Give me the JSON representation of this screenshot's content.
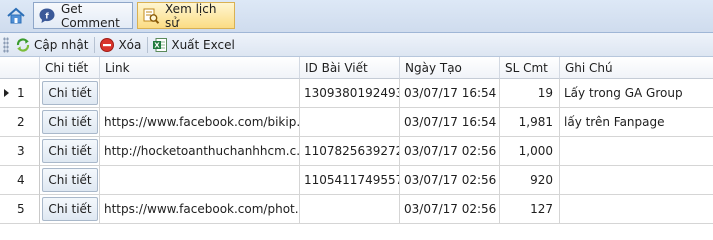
{
  "tabs": [
    {
      "label": "Get Comment",
      "icon": "facebook-comment-icon"
    },
    {
      "label": "Xem lịch sử",
      "icon": "history-search-icon"
    }
  ],
  "toolbar": {
    "refresh_label": "Cập nhật",
    "delete_label": "Xóa",
    "export_label": "Xuất Excel"
  },
  "columns": [
    "Chi tiết",
    "Link",
    "ID Bài Viết",
    "Ngày Tạo",
    "SL Cmt",
    "Ghi Chú"
  ],
  "rows": [
    {
      "num": "1",
      "detail": "Chi tiết",
      "link": "",
      "post_id": "1309380192493...",
      "date": "03/07/17 16:54",
      "count": "19",
      "note": "Lấy trong GA Group"
    },
    {
      "num": "2",
      "detail": "Chi tiết",
      "link": "https://www.facebook.com/bikip...",
      "post_id": "",
      "date": "03/07/17 16:54",
      "count": "1,981",
      "note": "lấy trên Fanpage"
    },
    {
      "num": "3",
      "detail": "Chi tiết",
      "link": "http://hocketoanthuchanhhcm.c...",
      "post_id": "1107825639272...",
      "date": "03/07/17 02:56",
      "count": "1,000",
      "note": ""
    },
    {
      "num": "4",
      "detail": "Chi tiết",
      "link": "",
      "post_id": "1105411749557...",
      "date": "03/07/17 02:56",
      "count": "920",
      "note": ""
    },
    {
      "num": "5",
      "detail": "Chi tiết",
      "link": "https://www.facebook.com/phot...",
      "post_id": "",
      "date": "03/07/17 02:56",
      "count": "127",
      "note": ""
    }
  ],
  "selected_row": 0
}
